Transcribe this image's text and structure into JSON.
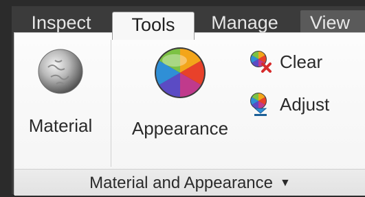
{
  "tabs": [
    {
      "label": "Inspect"
    },
    {
      "label": "Tools"
    },
    {
      "label": "Manage"
    },
    {
      "label": "View"
    }
  ],
  "active_tab": "Tools",
  "panel": {
    "buttons": {
      "material": "Material",
      "appearance": "Appearance",
      "clear": "Clear",
      "adjust": "Adjust"
    },
    "title": "Material and Appearance",
    "dropdown_icon": "triangle-down-icon"
  },
  "colors": {
    "ribbon_dark": "#3a3a3a",
    "panel_bg": "#f7f7f7",
    "footer_bg": "#e6e6e6",
    "clear_x": "#d62b2b",
    "adjust_arrow": "#2f8fd6"
  }
}
